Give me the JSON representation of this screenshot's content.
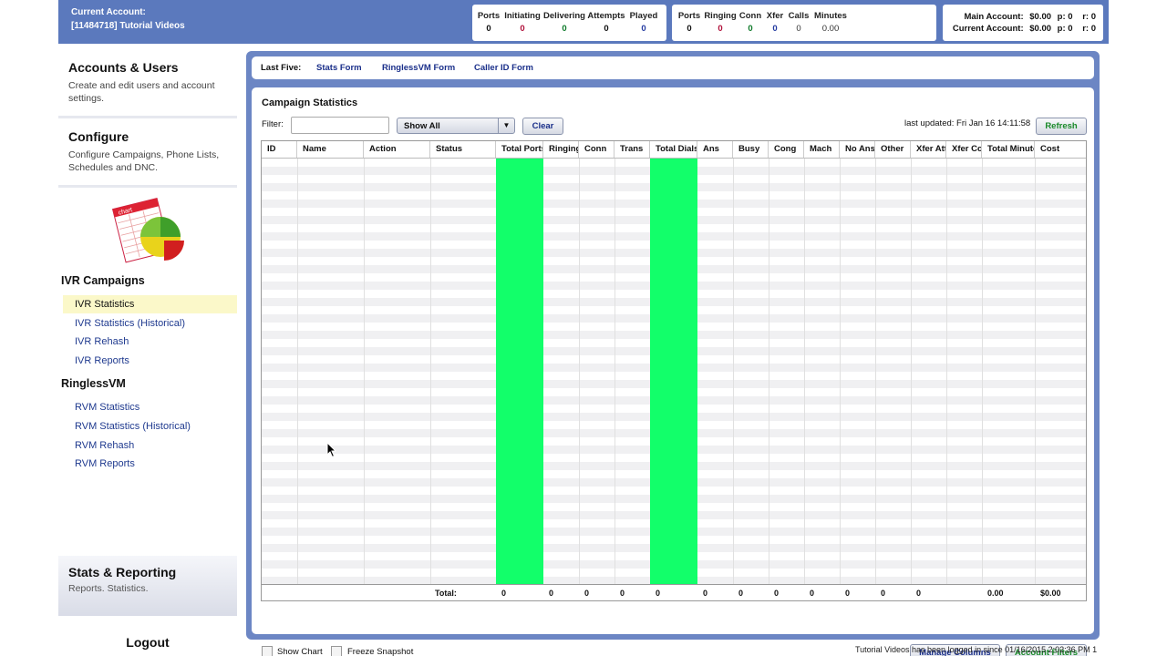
{
  "header": {
    "account_label": "Current Account:",
    "account_name": "[11484718] Tutorial Videos",
    "ivr_box": {
      "cols": [
        {
          "label": "Ports",
          "value": "0"
        },
        {
          "label": "Initiating",
          "value": "0"
        },
        {
          "label": "Delivering",
          "value": "0"
        },
        {
          "label": "Attempts",
          "value": "0"
        },
        {
          "label": "Played",
          "value": "0"
        }
      ]
    },
    "rvm_box": {
      "cols": [
        {
          "label": "Ports",
          "value": "0"
        },
        {
          "label": "Ringing",
          "value": "0"
        },
        {
          "label": "Conn",
          "value": "0"
        },
        {
          "label": "Xfer",
          "value": "0"
        },
        {
          "label": "Calls",
          "value": "0"
        },
        {
          "label": "Minutes",
          "value": "0.00"
        }
      ]
    },
    "balance": {
      "main_label": "Main Account:",
      "main_amount": "$0.00",
      "main_p": "p:  0",
      "main_r": "r:  0",
      "current_label": "Current Account:",
      "current_amount": "$0.00",
      "current_p": "p:  0",
      "current_r": "r:  0"
    }
  },
  "sidebar": {
    "accounts": {
      "title": "Accounts & Users",
      "desc": "Create and edit users and account settings."
    },
    "configure": {
      "title": "Configure",
      "desc": "Configure Campaigns, Phone Lists, Schedules and DNC."
    },
    "chart_icon_text": "chart",
    "ivr_group": "IVR Campaigns",
    "ivr_items": [
      "IVR Statistics",
      "IVR Statistics (Historical)",
      "IVR Rehash",
      "IVR Reports"
    ],
    "rvm_group": "RinglessVM",
    "rvm_items": [
      "RVM Statistics",
      "RVM Statistics (Historical)",
      "RVM Rehash",
      "RVM Reports"
    ],
    "stats": {
      "title": "Stats & Reporting",
      "desc": "Reports. Statistics."
    },
    "logout": "Logout"
  },
  "topbar": {
    "label": "Last Five:",
    "links": [
      "Stats Form",
      "RinglessVM Form",
      "Caller ID Form"
    ]
  },
  "panel": {
    "title": "Campaign Statistics",
    "filter_label": "Filter:",
    "filter_value": "",
    "select_value": "Show All",
    "clear_label": "Clear",
    "last_updated": "last updated: Fri Jan 16 14:11:58",
    "refresh_label": "Refresh",
    "columns": [
      "ID",
      "Name",
      "Action",
      "Status",
      "Total Ports",
      "Ringing",
      "Conn",
      "Trans",
      "Total Dials",
      "Ans",
      "Busy",
      "Cong",
      "Mach",
      "No Ans",
      "Other",
      "Xfer Att",
      "Xfer Cc",
      "Total Minutes",
      "Cost"
    ],
    "totals_label": "Total:",
    "totals": [
      "0",
      "0",
      "0",
      "0",
      "0",
      "0",
      "0",
      "0",
      "0",
      "0",
      "0",
      "0",
      "0.00",
      "$0.00"
    ],
    "show_chart_label": "Show Chart",
    "freeze_label": "Freeze Snapshot",
    "manage_columns_label": "Manage Columns",
    "account_filters_label": "Account Filters"
  },
  "footer": "Tutorial Videos has been logged in since 01/16/2015 2:02:36 PM 1",
  "colors": {
    "header": "#5b79bd",
    "frame": "#6c86c4",
    "highlight_column": "#12ff6a",
    "active_nav": "#fbf8c9"
  }
}
